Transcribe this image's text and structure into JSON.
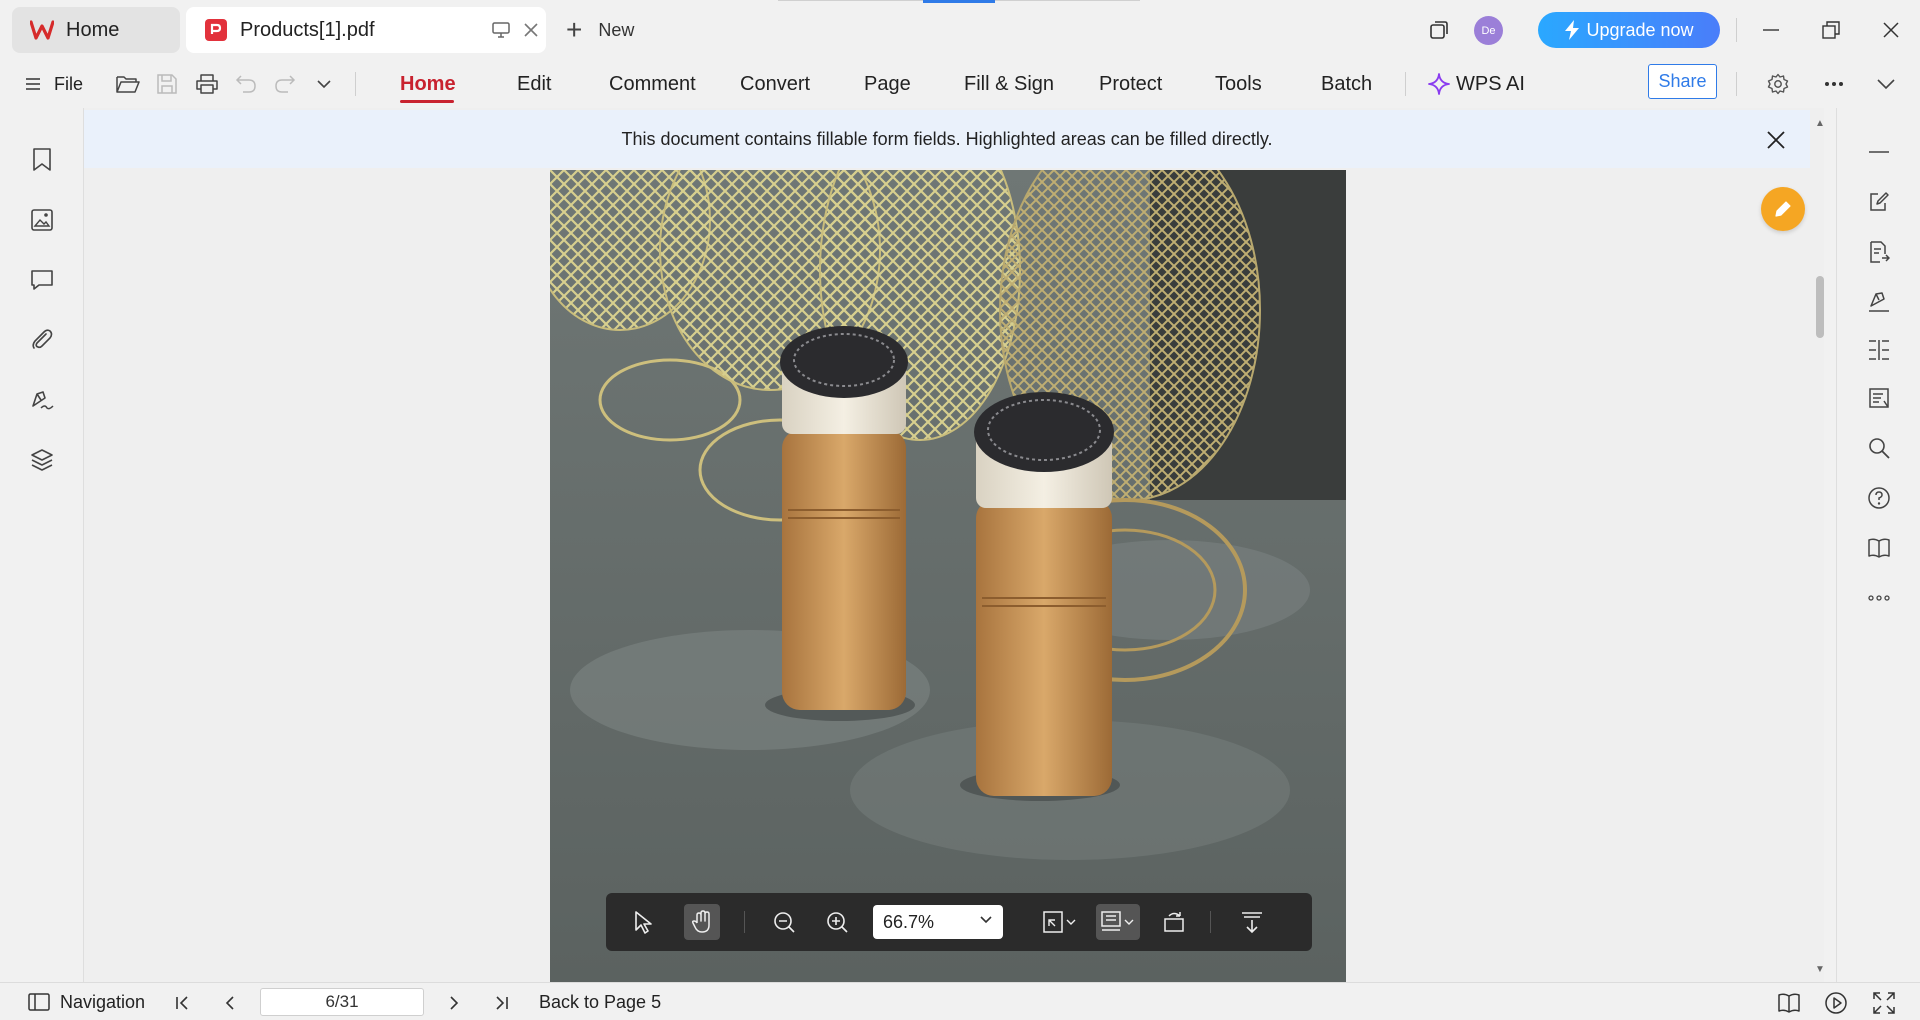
{
  "tabs": [
    {
      "label": "Home",
      "icon": "wps-logo-icon"
    },
    {
      "label": "Products[1].pdf",
      "icon": "pdf-file-icon"
    }
  ],
  "new_tab_label": "New",
  "account": {
    "avatar_initials": "De",
    "upgrade_label": "Upgrade now"
  },
  "ribbon": {
    "file_label": "File",
    "menus": [
      "Home",
      "Edit",
      "Comment",
      "Convert",
      "Page",
      "Fill & Sign",
      "Protect",
      "Tools",
      "Batch"
    ],
    "active_menu": "Home",
    "ai_label": "WPS AI",
    "share_label": "Share"
  },
  "notice": {
    "text": "This document contains fillable form fields. Highlighted areas can be filled directly."
  },
  "zoom": {
    "value": "66.7%"
  },
  "status": {
    "navigation_label": "Navigation",
    "page_indicator": "6/31",
    "back_label": "Back to Page 5"
  },
  "colors": {
    "accent_red": "#c8222f",
    "accent_blue": "#2f7be8",
    "upgrade_gradient_start": "#2aa8ff",
    "upgrade_gradient_end": "#4a7dfa",
    "edit_fab": "#f5a623"
  }
}
